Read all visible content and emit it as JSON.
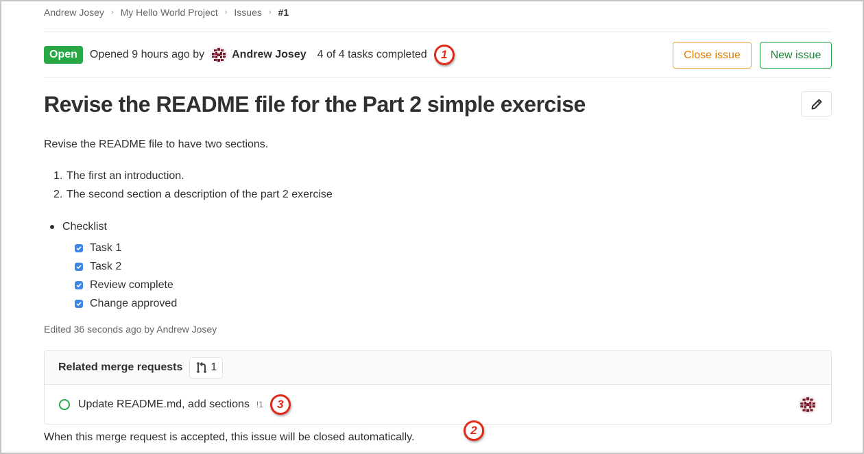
{
  "breadcrumb": {
    "items": [
      "Andrew Josey",
      "My Hello World Project",
      "Issues",
      "#1"
    ],
    "separator": "›"
  },
  "issue": {
    "status": "Open",
    "opened_text": "Opened 9 hours ago by",
    "author": "Andrew Josey",
    "tasks": "4 of 4 tasks completed",
    "title": "Revise the README file for the Part 2 simple exercise",
    "description": "Revise the README file to have two sections.",
    "ordered_list": [
      {
        "num": "1.",
        "text": "The first an introduction."
      },
      {
        "num": "2.",
        "text": "The second section a description of the part 2 exercise"
      }
    ],
    "bullet": "Checklist",
    "checklist": [
      {
        "label": "Task 1",
        "checked": true
      },
      {
        "label": "Task 2",
        "checked": true
      },
      {
        "label": "Review complete",
        "checked": true
      },
      {
        "label": "Change approved",
        "checked": true
      }
    ],
    "edited": "Edited 36 seconds ago by Andrew Josey"
  },
  "actions": {
    "close_label": "Close issue",
    "new_label": "New issue"
  },
  "related": {
    "title": "Related merge requests",
    "count": "1",
    "items": [
      {
        "title": "Update README.md, add sections",
        "ref": "!1"
      }
    ],
    "note": "When this merge request is accepted, this issue will be closed automatically."
  },
  "annotations": [
    "1",
    "2",
    "3"
  ],
  "colors": {
    "open": "#28a745",
    "close_border": "#e9a23b",
    "close_text": "#de7e00",
    "new": "#1f8a3a",
    "annotation": "#e32a1a",
    "checkbox": "#3c86e8"
  }
}
